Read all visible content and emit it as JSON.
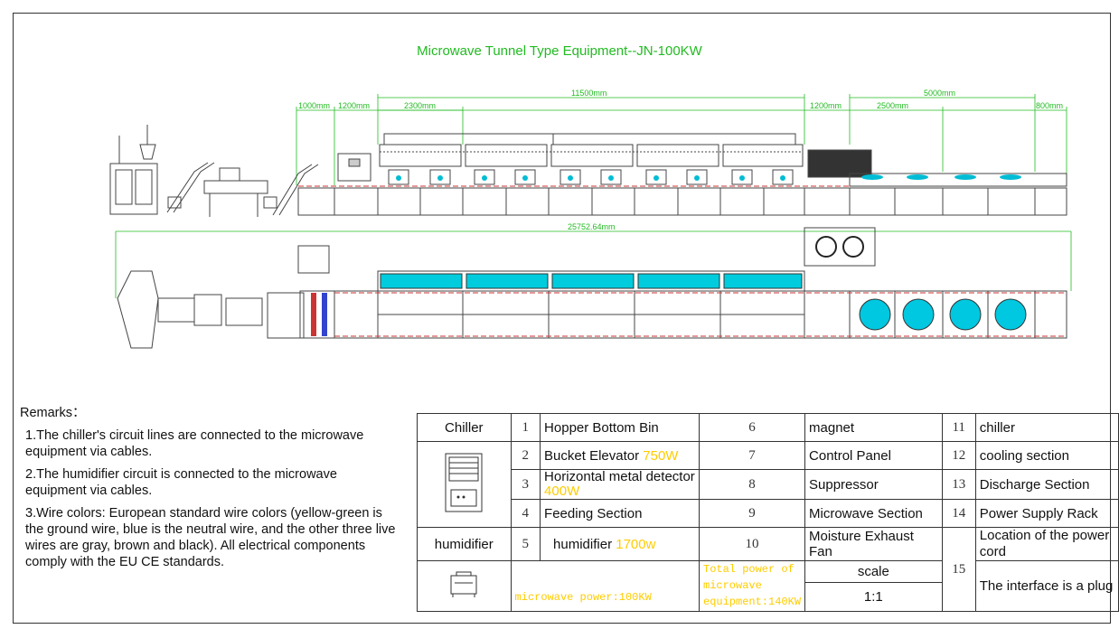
{
  "title": "Microwave Tunnel Type Equipment--JN-100KW",
  "dimensions": {
    "d1000": "1000mm",
    "d1200a": "1200mm",
    "d2300": "2300mm",
    "d11500": "11500mm",
    "d1200b": "1200mm",
    "d2500": "2500mm",
    "d5000": "5000mm",
    "d800": "800mm",
    "d25752": "25752.64mm"
  },
  "remarks": {
    "heading": "Remarks：",
    "r1": "1.The chiller's circuit lines are connected to the microwave equipment via cables.",
    "r2": "2.The humidifier circuit is connected to the microwave equipment via cables.",
    "r3": "3.Wire colors: European standard wire colors (yellow-green is the ground wire, blue is the neutral wire, and the other three live wires are gray, brown and black). All electrical components comply with the EU CE standards."
  },
  "bom": {
    "chiller_label": "Chiller",
    "humidifier_label": "humidifier",
    "n1": "1",
    "i1": "Hopper Bottom Bin",
    "n2": "2",
    "i2": "Bucket Elevator",
    "p2": "750W",
    "n3": "3",
    "i3": "Horizontal metal detector",
    "p3": "400W",
    "n4": "4",
    "i4": "Feeding Section",
    "n5": "5",
    "i5": "humidifier",
    "p5": "1700w",
    "n6": "6",
    "i6": "magnet",
    "n7": "7",
    "i7": "Control Panel",
    "n8": "8",
    "i8": "Suppressor",
    "n9": "9",
    "i9": "Microwave Section",
    "n10": "10",
    "i10": "Moisture Exhaust Fan",
    "n11": "11",
    "i11": "chiller",
    "n12": "12",
    "i12": "cooling section",
    "n13": "13",
    "i13": "Discharge Section",
    "n14": "14",
    "i14": "Power Supply Rack",
    "n15": "15",
    "i15a": "Location of the power cord",
    "i15b": "The interface is a plug",
    "microwave_power": "microwave power:100KW",
    "total_power": "Total power of microwave equipment:140KW",
    "scale_label": "scale",
    "scale_value": "1:1"
  },
  "colors": {
    "dimension": "#22bb22",
    "accent": "#00bcd4",
    "conveyor": "#cc3333",
    "note": "#ffcc00"
  }
}
